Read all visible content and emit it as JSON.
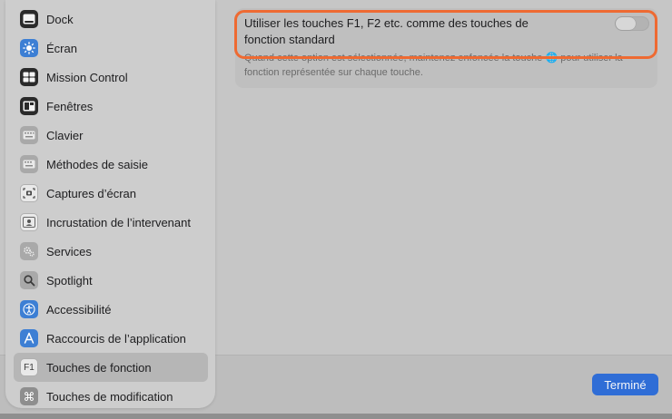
{
  "sidebar": {
    "items": [
      {
        "label": "Dock",
        "icon": "dock-icon"
      },
      {
        "label": "Écran",
        "icon": "display-brightness-icon"
      },
      {
        "label": "Mission Control",
        "icon": "mission-control-icon"
      },
      {
        "label": "Fenêtres",
        "icon": "windows-icon"
      },
      {
        "label": "Clavier",
        "icon": "keyboard-icon"
      },
      {
        "label": "Méthodes de saisie",
        "icon": "input-methods-icon"
      },
      {
        "label": "Captures d’écran",
        "icon": "screenshot-icon"
      },
      {
        "label": "Incrustation de l’intervenant",
        "icon": "presenter-overlay-icon"
      },
      {
        "label": "Services",
        "icon": "services-gear-icon"
      },
      {
        "label": "Spotlight",
        "icon": "spotlight-magnifier-icon"
      },
      {
        "label": "Accessibilité",
        "icon": "accessibility-icon"
      },
      {
        "label": "Raccourcis de l’application",
        "icon": "app-shortcuts-icon"
      },
      {
        "label": "Touches de fonction",
        "icon": "function-keys-icon",
        "icon_text": "F1"
      },
      {
        "label": "Touches de modification",
        "icon": "modifier-keys-icon",
        "icon_text": "⌘"
      }
    ],
    "selected_index": 12
  },
  "option": {
    "title": "Utiliser les touches F1, F2 etc. comme des touches de fonction standard",
    "description": "Quand cette option est sélectionnée, maintenez enfoncée la touche 🌐 pour utiliser la fonction représentée sur chaque touche.",
    "toggle_on": false
  },
  "footer": {
    "done_label": "Terminé"
  },
  "colors": {
    "highlight": "#ee6a32",
    "accent": "#2f6dd6"
  }
}
